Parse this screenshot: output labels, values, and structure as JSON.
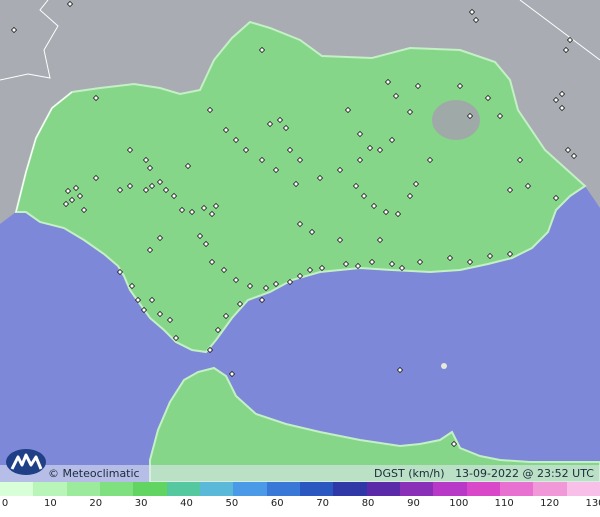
{
  "map": {
    "brand": "Meteoclimatic",
    "variable": "DGST (km/h)",
    "timestamp": "13-09-2022 @ 23:52 UTC",
    "colors": {
      "sea": "#7d88d8",
      "land_outside": "#a9acb3",
      "region": "#86d68a",
      "region_edge": "#bfeec0",
      "border": "#ffffff"
    }
  },
  "legend": {
    "ticks": [
      "0",
      "10",
      "20",
      "30",
      "40",
      "50",
      "60",
      "70",
      "80",
      "90",
      "100",
      "110",
      "120",
      "130"
    ],
    "colors": [
      "#d8ffd8",
      "#b9f5b9",
      "#9ceb9c",
      "#7fe07f",
      "#62d462",
      "#55c8a0",
      "#5ab8d8",
      "#4a9ae8",
      "#3a78d8",
      "#2a58c0",
      "#3038a8",
      "#5a2aa8",
      "#8a30b8",
      "#b838c8",
      "#d848c8",
      "#e870d0",
      "#f098d8",
      "#f8c0e8"
    ]
  }
}
